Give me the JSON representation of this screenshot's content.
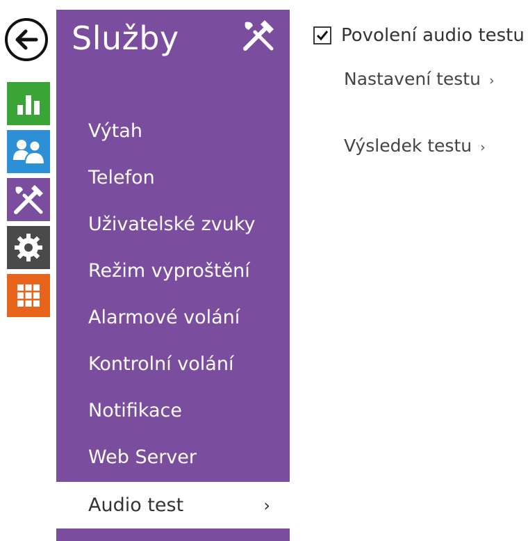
{
  "menu": {
    "title": "Služby",
    "bg_color": "#7b4d9f",
    "header_icon": "tools-icon",
    "items": [
      {
        "label": "Výtah",
        "active": false
      },
      {
        "label": "Telefon",
        "active": false
      },
      {
        "label": "Uživatelské zvuky",
        "active": false
      },
      {
        "label": "Režim vyproštění",
        "active": false
      },
      {
        "label": "Alarmové volání",
        "active": false
      },
      {
        "label": "Kontrolní volání",
        "active": false
      },
      {
        "label": "Notifikace",
        "active": false
      },
      {
        "label": "Web Server",
        "active": false
      },
      {
        "label": "Audio test",
        "active": true,
        "chevron": "›"
      }
    ]
  },
  "rail": {
    "back_icon": "back-arrow-icon",
    "icons": [
      {
        "name": "status-icon",
        "color": "#3aa536"
      },
      {
        "name": "directory-icon",
        "color": "#2d8fd6"
      },
      {
        "name": "services-icon",
        "color": "#7b4d9f"
      },
      {
        "name": "system-icon",
        "color": "#4a4a4a"
      },
      {
        "name": "hardware-icon",
        "color": "#e8641d"
      }
    ]
  },
  "content": {
    "enable_checkbox": {
      "label": "Povolení audio testu",
      "checked": true
    },
    "links": [
      {
        "label": "Nastavení testu",
        "arrow": "›"
      },
      {
        "label": "Výsledek testu",
        "arrow": "›"
      }
    ]
  }
}
